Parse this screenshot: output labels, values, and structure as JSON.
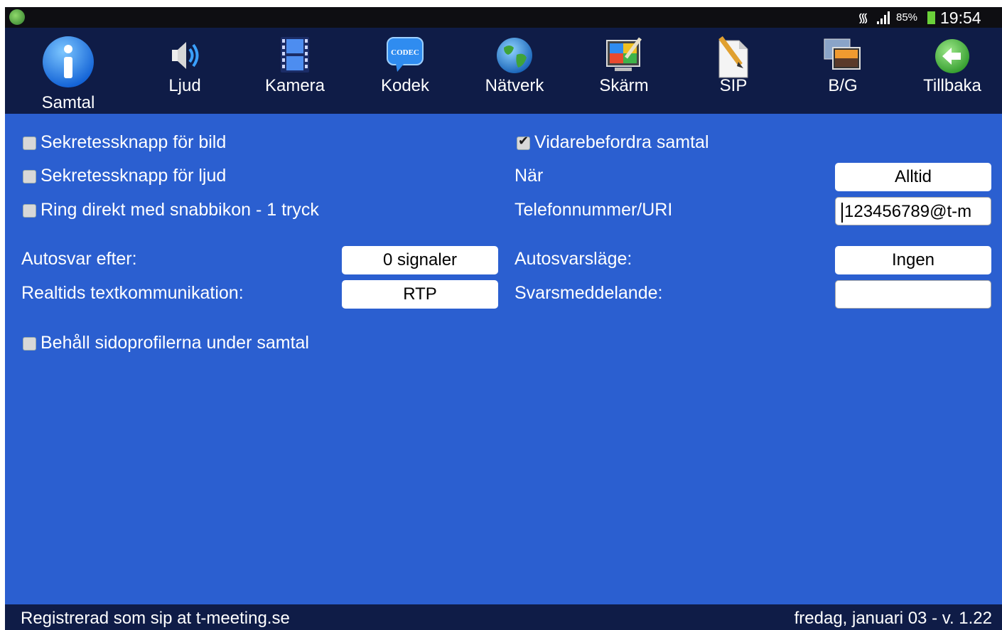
{
  "status_bar": {
    "app_icon": "meeting-app-icon",
    "battery_percent": "85%",
    "time": "19:54"
  },
  "toolbar": {
    "items": [
      {
        "label": "Samtal",
        "icon": "info-icon",
        "selected": true
      },
      {
        "label": "Ljud",
        "icon": "speaker-icon"
      },
      {
        "label": "Kamera",
        "icon": "film-icon"
      },
      {
        "label": "Kodek",
        "icon": "codec-icon",
        "badge": "CODEC"
      },
      {
        "label": "Nätverk",
        "icon": "globe-icon"
      },
      {
        "label": "Skärm",
        "icon": "display-paint-icon"
      },
      {
        "label": "SIP",
        "icon": "document-pencil-icon"
      },
      {
        "label": "B/G",
        "icon": "background-image-icon"
      },
      {
        "label": "Tillbaka",
        "icon": "back-arrow-icon"
      }
    ]
  },
  "settings": {
    "privacy_video": {
      "label": "Sekretessknapp för bild",
      "checked": false
    },
    "privacy_audio": {
      "label": "Sekretessknapp för ljud",
      "checked": false
    },
    "one_tap_dial": {
      "label": "Ring direkt med snabbikon - 1 tryck",
      "checked": false
    },
    "forward_calls": {
      "label": "Vidarebefordra samtal",
      "checked": true
    },
    "when_label": "När",
    "when_value": "Alltid",
    "phone_label": "Telefonnummer/URI",
    "phone_value": "123456789@t-m",
    "autoanswer_label": "Autosvar efter:",
    "autoanswer_value": "0 signaler",
    "autoanswer_mode_label": "Autosvarsläge:",
    "autoanswer_mode_value": "Ingen",
    "rtt_label": "Realtids textkommunikation:",
    "rtt_value": "RTP",
    "reply_message_label": "Svarsmeddelande:",
    "reply_message_value": "",
    "keep_side_profiles": {
      "label": "Behåll sidoprofilerna under samtal",
      "checked": false
    }
  },
  "footer": {
    "registration": "Registrerad som sip at t-meeting.se",
    "date_version": "fredag, januari 03 - v. 1.22"
  },
  "colors": {
    "background": "#2b5fd0",
    "toolbar": "#0f1c47",
    "statusbar": "#0e0e12"
  }
}
